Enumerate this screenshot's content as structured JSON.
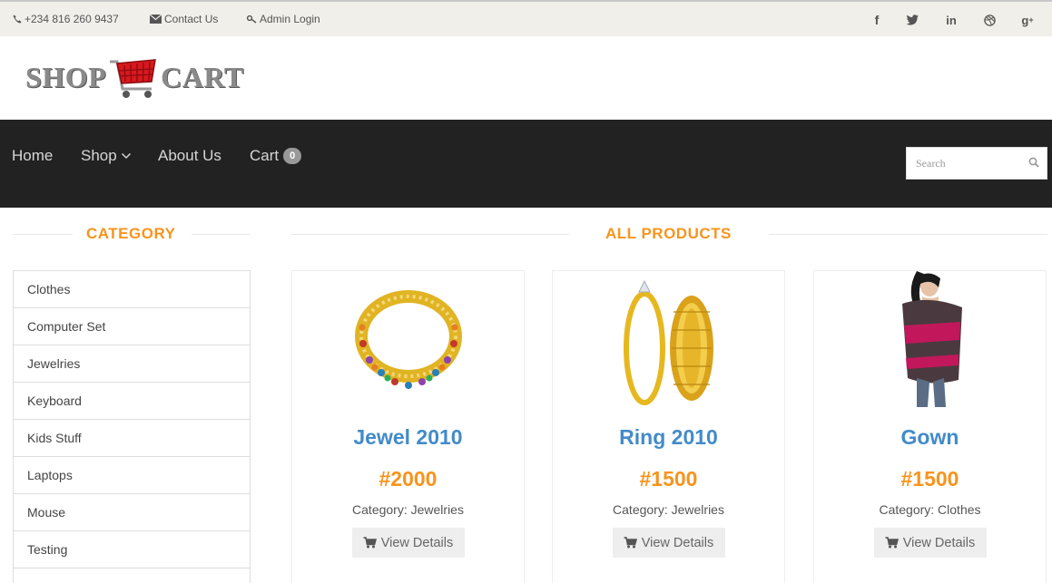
{
  "topbar": {
    "phone": "+234 816 260 9437",
    "contact": "Contact Us",
    "admin": "Admin Login",
    "social": [
      "facebook-icon",
      "twitter-icon",
      "linkedin-icon",
      "dribbble-icon",
      "google-plus-icon"
    ]
  },
  "logo": {
    "left": "SHOP",
    "right": "CART"
  },
  "nav": {
    "home": "Home",
    "shop": "Shop",
    "about": "About Us",
    "cart": "Cart",
    "cart_count": "0",
    "search_placeholder": "Search"
  },
  "sidebar": {
    "title": "CATEGORY",
    "items": [
      "Clothes",
      "Computer Set",
      "Jewelries",
      "Keyboard",
      "Kids Stuff",
      "Laptops",
      "Mouse",
      "Testing"
    ]
  },
  "products": {
    "title": "ALL PRODUCTS",
    "button_label": "View Details",
    "items": [
      {
        "name": "Jewel 2010",
        "price": "#2000",
        "category": "Category: Jewelries"
      },
      {
        "name": "Ring 2010",
        "price": "#1500",
        "category": "Category: Jewelries"
      },
      {
        "name": "Gown",
        "price": "#1500",
        "category": "Category: Clothes"
      }
    ]
  },
  "colors": {
    "accent": "#f7941d",
    "link": "#428bca",
    "nav_bg": "#222222",
    "topbar_bg": "#f0efea"
  }
}
